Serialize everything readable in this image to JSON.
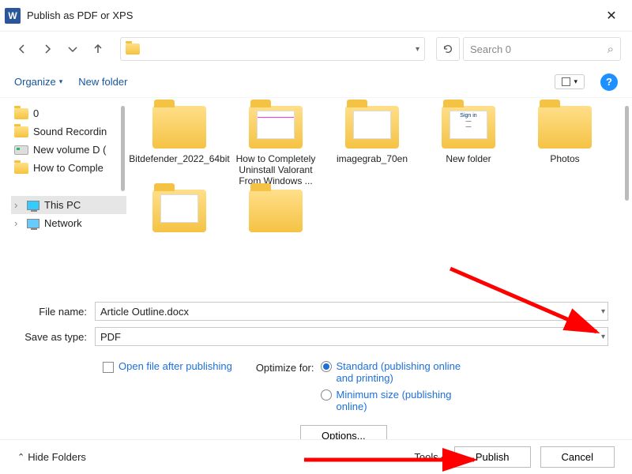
{
  "window": {
    "title": "Publish as PDF or XPS"
  },
  "nav": {
    "refresh": "↻"
  },
  "search": {
    "placeholder": "Search 0",
    "icon": "⌕"
  },
  "toolbar": {
    "organize": "Organize",
    "newfolder": "New folder",
    "help": "?"
  },
  "tree": {
    "items": [
      {
        "label": "0",
        "kind": "folder"
      },
      {
        "label": "Sound Recordin",
        "kind": "folder"
      },
      {
        "label": "New volume D (",
        "kind": "drive"
      },
      {
        "label": "How to Comple",
        "kind": "folder"
      }
    ],
    "thispc": "This PC",
    "network": "Network"
  },
  "grid": {
    "items": [
      {
        "label": "Bitdefender_2022_64bit",
        "overlay": ""
      },
      {
        "label": "How to Completely Uninstall Valorant From Windows ...",
        "overlay": "preview"
      },
      {
        "label": "imagegrab_70en",
        "overlay": "doc"
      },
      {
        "label": "New folder",
        "overlay": "signup"
      },
      {
        "label": "Photos",
        "overlay": ""
      },
      {
        "label": "",
        "overlay": "doc"
      },
      {
        "label": "",
        "overlay": ""
      }
    ]
  },
  "form": {
    "filename_label": "File name:",
    "filename_value": "Article Outline.docx",
    "saveas_label": "Save as type:",
    "saveas_value": "PDF"
  },
  "options": {
    "openafter": "Open file after publishing",
    "optimize_label": "Optimize for:",
    "standard": "Standard (publishing online and printing)",
    "minimum": "Minimum size (publishing online)",
    "options_btn": "Options..."
  },
  "footer": {
    "hide": "Hide Folders",
    "tools": "Tools",
    "publish": "Publish",
    "cancel": "Cancel"
  }
}
